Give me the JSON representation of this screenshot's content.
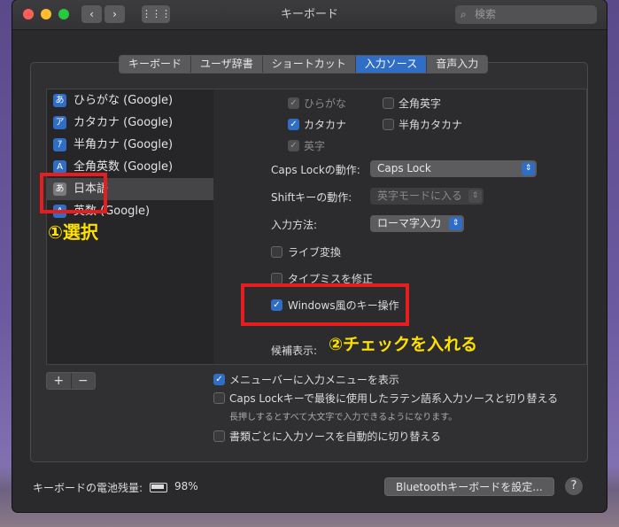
{
  "window": {
    "title": "キーボード"
  },
  "search": {
    "placeholder": "検索",
    "icon": "search-icon"
  },
  "nav": {
    "back": "‹",
    "forward": "›",
    "grid": "⋮⋮⋮"
  },
  "tabs": [
    {
      "label": "キーボード",
      "active": false
    },
    {
      "label": "ユーザ辞書",
      "active": false
    },
    {
      "label": "ショートカット",
      "active": false
    },
    {
      "label": "入力ソース",
      "active": true
    },
    {
      "label": "音声入力",
      "active": false
    }
  ],
  "sources": [
    {
      "badge": "あ",
      "label": "ひらがな (Google)"
    },
    {
      "badge": "ア",
      "label": "カタカナ (Google)"
    },
    {
      "badge": "ｱ",
      "label": "半角カナ (Google)"
    },
    {
      "badge": "A",
      "label": "全角英数 (Google)"
    },
    {
      "badge": "あ",
      "label": "日本語",
      "selected": true
    },
    {
      "badge": "A",
      "label": "英数 (Google)"
    }
  ],
  "add_remove": {
    "add": "+",
    "remove": "−"
  },
  "modes": [
    {
      "label": "ひらがな",
      "checked": true,
      "disabled": true
    },
    {
      "label": "全角英字",
      "checked": false,
      "disabled": false
    },
    {
      "label": "カタカナ",
      "checked": true,
      "disabled": false
    },
    {
      "label": "半角カタカナ",
      "checked": false,
      "disabled": false
    },
    {
      "label": "英字",
      "checked": true,
      "disabled": true
    }
  ],
  "settings": {
    "capslock_label": "Caps Lockの動作:",
    "capslock_value": "Caps Lock",
    "shift_label": "Shiftキーの動作:",
    "shift_value": "英字モードに入る",
    "input_label": "入力方法:",
    "input_value": "ローマ字入力",
    "live": "ライブ変換",
    "typo": "タイプミスを修正",
    "windows": "Windows風のキー操作",
    "candidates": "候補表示:"
  },
  "annotations": {
    "select": "①選択",
    "check": "②チェックを入れる"
  },
  "bottom": {
    "menu": "メニューバーに入力メニューを表示",
    "capslock": "Caps Lockキーで最後に使用したラテン語系入力ソースと切り替える",
    "capslock_sub": "長押しするとすべて大文字で入力できるようになります。",
    "auto": "書類ごとに入力ソースを自動的に切り替える"
  },
  "footer": {
    "battery_label": "キーボードの電池残量:",
    "battery_value": "98%",
    "bt_button": "Bluetoothキーボードを設定...",
    "help": "?"
  },
  "colors": {
    "accent": "#2f6ec4",
    "annotation": "#ffe100",
    "highlight": "#e81d1d"
  }
}
